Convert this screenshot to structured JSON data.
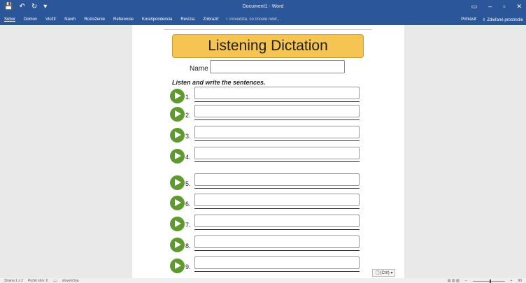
{
  "titlebar": {
    "title": "Document1 - Word",
    "save_icon": "💾",
    "undo_icon": "↶",
    "redo_icon": "↻",
    "customize_icon": "▾",
    "ribbon_options_icon": "▭",
    "minimize_icon": "–",
    "restore_icon": "▫",
    "close_icon": "✕"
  },
  "ribbon": {
    "tabs": [
      "Súbor",
      "Domov",
      "Vložiť",
      "Návrh",
      "Rozloženie",
      "Referencie",
      "Korešpondencia",
      "Revízia",
      "Zobraziť"
    ],
    "tell_me": "♀ Povedzte, čo chcete robiť...",
    "sign_in": "Prihlásiť",
    "share": "♗ Zdieľané prostredie"
  },
  "document": {
    "title": "Listening Dictation",
    "name_label": "Name",
    "instruction": "Listen and write the sentences.",
    "items": [
      "1.",
      "2.",
      "3.",
      "4.",
      "5.",
      "6.",
      "7.",
      "8.",
      "9."
    ],
    "paste_options": "📋(Ctrl) ▾"
  },
  "statusbar": {
    "page": "Strana 1 z 2",
    "words": "Počet slov: 0",
    "proofing_icon": "📖",
    "language": "slovenčina",
    "view_icons": "▤  ▥  ▧",
    "zoom_minus": "–",
    "zoom_plus": "+",
    "zoom_level": "90"
  }
}
